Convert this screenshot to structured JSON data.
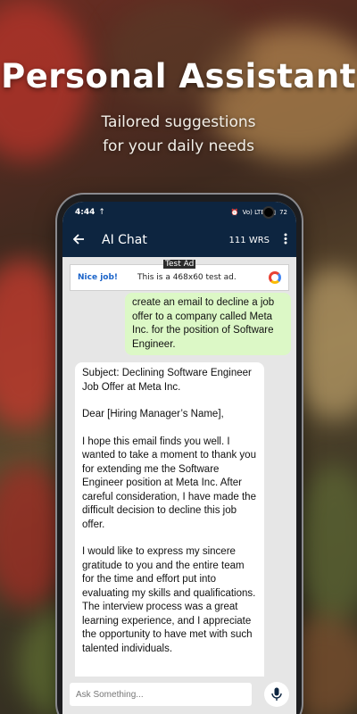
{
  "promo": {
    "headline": "Personal Assistant",
    "subtitle_line1": "Tailored suggestions",
    "subtitle_line2": "for your daily needs"
  },
  "status_bar": {
    "time": "4:44",
    "network": "Vo) LTE1",
    "battery": "72"
  },
  "app_bar": {
    "back_icon": "arrow-left-icon",
    "title": "AI Chat",
    "word_count": "111 WRS",
    "menu_icon": "more-vert-icon"
  },
  "ad": {
    "label": "Test Ad",
    "brand": "Nice job!",
    "text": "This is a 468x60 test ad."
  },
  "messages": {
    "user": "create an email to decline a job offer to a company called Meta Inc. for the position of Software Engineer.",
    "bot_p1": "Subject: Declining Software Engineer Job Offer at Meta Inc.",
    "bot_p2": "Dear [Hiring Manager’s Name],",
    "bot_p3": "I hope this email finds you well. I wanted to take a moment to thank you for extending me the Software Engineer position at Meta Inc. After careful consideration, I have made the difficult decision to decline this job offer.",
    "bot_p4": "I would like to express my sincere gratitude to you and the entire team for the time and effort put into evaluating my skills and qualifications. The interview process was a great learning experience, and I appreciate the opportunity to have met with such talented individuals."
  },
  "composer": {
    "placeholder": "Ask Something...",
    "mic_icon": "microphone-icon"
  },
  "colors": {
    "app_bar": "#0d2540",
    "user_bubble": "#dcf8c6",
    "chat_bg": "#e6e6e6",
    "ad_link": "#1a63c9"
  }
}
